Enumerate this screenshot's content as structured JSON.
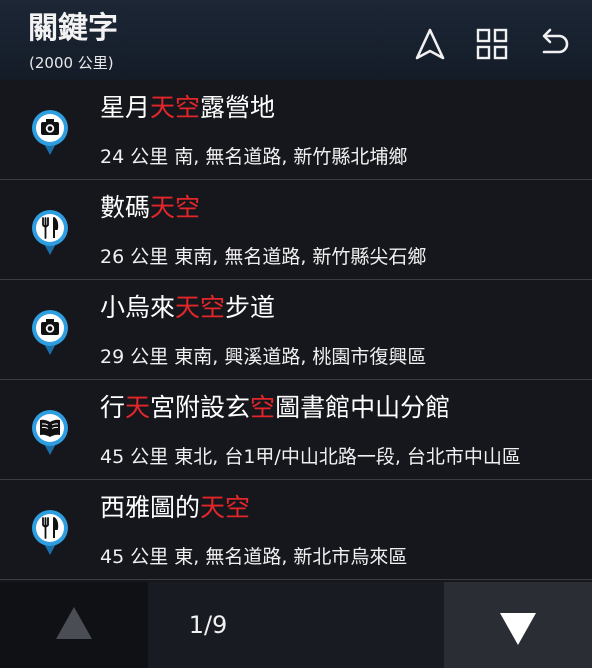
{
  "header": {
    "title": "關鍵字",
    "subtitle": "(2000 公里)",
    "buttons": [
      {
        "icon": "navigate-arrow-icon"
      },
      {
        "icon": "grid-icon"
      },
      {
        "icon": "back-icon"
      }
    ]
  },
  "results": [
    {
      "icon": "camera-pin-icon",
      "name": [
        "星月",
        "天空",
        "露營地"
      ],
      "detail": "24 公里 南, 無名道路, 新竹縣北埔鄉"
    },
    {
      "icon": "restaurant-pin-icon",
      "name": [
        "數碼",
        "天空",
        ""
      ],
      "detail": "26 公里 東南, 無名道路, 新竹縣尖石鄉"
    },
    {
      "icon": "camera-pin-icon",
      "name": [
        "小烏來",
        "天空",
        "步道"
      ],
      "detail": "29 公里 東南, 興溪道路, 桃園市復興區"
    },
    {
      "icon": "book-pin-icon",
      "name": [
        "行",
        "天",
        "宮附設玄",
        "空",
        "圖書館中山分館"
      ],
      "detail": "45 公里 東北, 台1甲/中山北路一段, 台北市中山區"
    },
    {
      "icon": "restaurant-pin-icon",
      "name": [
        "西雅圖的",
        "天空",
        ""
      ],
      "detail": "45 公里 東, 無名道路, 新北市烏來區"
    }
  ],
  "pagination": {
    "text": "1/9",
    "prev_icon": "up-triangle-icon",
    "next_icon": "down-triangle-icon"
  },
  "colors": {
    "highlight": "#e3262a",
    "pin_blue": "#2f9ee0"
  }
}
